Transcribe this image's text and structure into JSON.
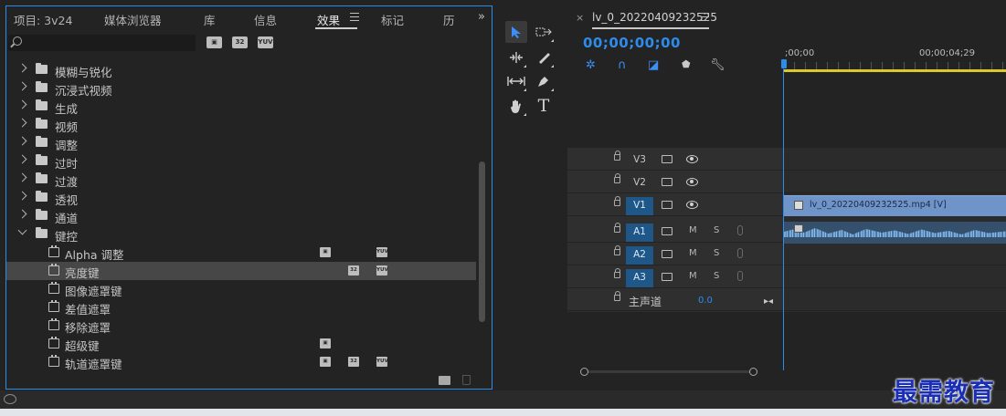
{
  "effects_panel": {
    "tabs": [
      {
        "label": "项目: 3v24"
      },
      {
        "label": "媒体浏览器"
      },
      {
        "label": "库"
      },
      {
        "label": "信息"
      },
      {
        "label": "效果"
      },
      {
        "label": "标记"
      },
      {
        "label": "历"
      }
    ],
    "active_tab": "效果",
    "overflow_glyph": "»",
    "search": {
      "value": "",
      "placeholder": ""
    },
    "filter_buttons": [
      "accelerated-icon",
      "32-bit-icon",
      "yuv-icon"
    ],
    "filter_labels": {
      "b32": "32",
      "yuv": "YUV"
    },
    "folders": [
      {
        "label": "模糊与锐化",
        "expanded": false
      },
      {
        "label": "沉浸式视频",
        "expanded": false
      },
      {
        "label": "生成",
        "expanded": false
      },
      {
        "label": "视频",
        "expanded": false
      },
      {
        "label": "调整",
        "expanded": false
      },
      {
        "label": "过时",
        "expanded": false
      },
      {
        "label": "过渡",
        "expanded": false
      },
      {
        "label": "透视",
        "expanded": false
      },
      {
        "label": "通道",
        "expanded": false
      },
      {
        "label": "键控",
        "expanded": true
      }
    ],
    "keying_effects": [
      {
        "label": "Alpha 调整",
        "accelerated": true,
        "b32": false,
        "yuv": true
      },
      {
        "label": "亮度键",
        "accelerated": false,
        "b32": true,
        "yuv": true,
        "selected": true
      },
      {
        "label": "图像遮罩键",
        "accelerated": false,
        "b32": false,
        "yuv": false
      },
      {
        "label": "差值遮罩",
        "accelerated": false,
        "b32": false,
        "yuv": false
      },
      {
        "label": "移除遮罩",
        "accelerated": false,
        "b32": false,
        "yuv": false
      },
      {
        "label": "超级键",
        "accelerated": true,
        "b32": false,
        "yuv": false
      },
      {
        "label": "轨道遮罩键",
        "accelerated": true,
        "b32": true,
        "yuv": true
      }
    ]
  },
  "tools": {
    "items": [
      "selection-tool",
      "track-select-forward-tool",
      "ripple-edit-tool",
      "razor-tool",
      "slip-tool",
      "pen-tool",
      "hand-tool",
      "type-tool"
    ],
    "active": "selection-tool",
    "type_glyph": "T"
  },
  "timeline": {
    "sequence_name": "lv_0_20220409232525",
    "close_glyph": "×",
    "timecode": "00;00;00;00",
    "ruler_labels": [
      ";00;00",
      "00;00;04;29"
    ],
    "video_tracks": [
      {
        "name": "V3",
        "targeted": false
      },
      {
        "name": "V2",
        "targeted": false
      },
      {
        "name": "V1",
        "targeted": true
      }
    ],
    "audio_tracks": [
      {
        "name": "A1",
        "targeted": true,
        "m": "M",
        "s": "S"
      },
      {
        "name": "A2",
        "targeted": true,
        "m": "M",
        "s": "S"
      },
      {
        "name": "A3",
        "targeted": true,
        "m": "M",
        "s": "S"
      }
    ],
    "master": {
      "label": "主声道",
      "value": "0.0"
    },
    "video_clip": {
      "label": "lv_0_20220409232525.mp4 [V]"
    }
  },
  "watermark": "最需教育",
  "colors": {
    "accent": "#2d8ceb",
    "clip_video": "#6f94c9",
    "clip_audio": "#35506c",
    "work_area": "#d9c92b"
  }
}
